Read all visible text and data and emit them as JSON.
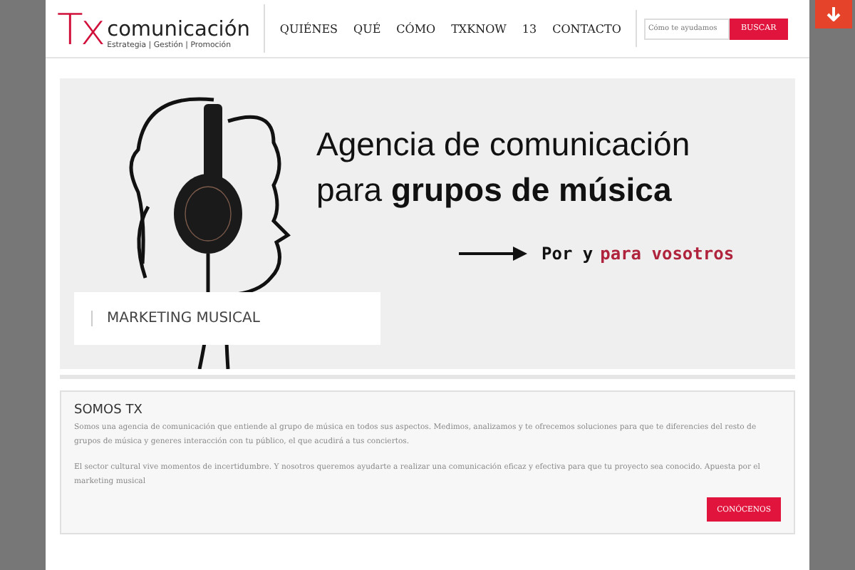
{
  "logo": {
    "mark": "Tx",
    "name": "comunicación",
    "tagline": "Estrategia | Gestión | Promoción"
  },
  "nav": [
    {
      "label": "QUIÉNES"
    },
    {
      "label": "QUÉ"
    },
    {
      "label": "CÓMO"
    },
    {
      "label": "TXKNOW"
    },
    {
      "label": "13"
    },
    {
      "label": "CONTACTO"
    }
  ],
  "search": {
    "placeholder": "Cómo te ayudamos",
    "button": "BUSCAR"
  },
  "hero": {
    "headline_1": "Agencia de comunicación",
    "headline_2": "para **grupos de música**",
    "tagline_start": "Por y",
    "tagline_accent": "para vosotros",
    "caption": "MARKETING MUSICAL"
  },
  "about": {
    "title": "SOMOS TX",
    "paragraphs": [
      "Somos una agencia de comunicación que entiende al grupo de música en todos sus aspectos. Medimos, analizamos y te ofrecemos soluciones para que te diferencies del resto de grupos de música y generes interacción con tu público, el que acudirá a tus conciertos.",
      "El sector cultural vive momentos de incertidumbre. Y nosotros queremos ayudarte a realizar una comunicación eficaz y efectiva para que tu proyecto sea conocido. Apuesta por el marketing musical"
    ],
    "button": "CONÓCENOS"
  }
}
